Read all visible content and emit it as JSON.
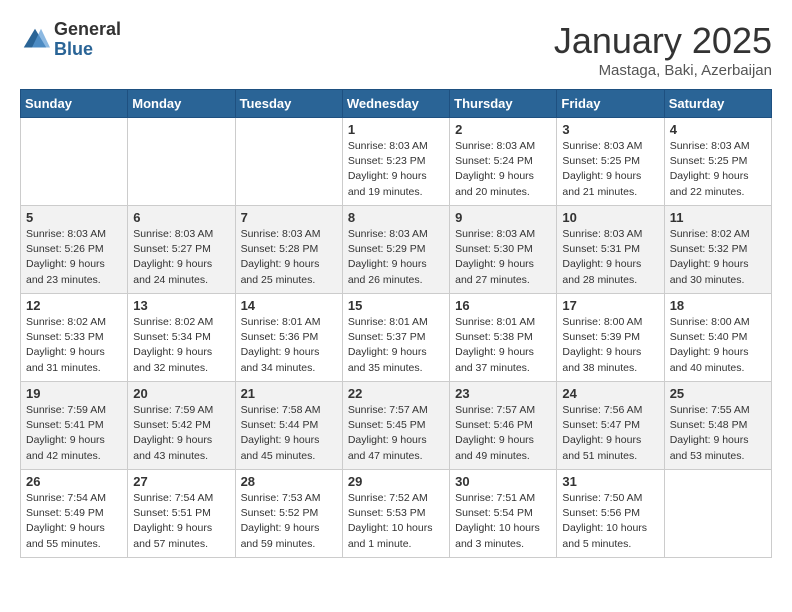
{
  "header": {
    "logo_general": "General",
    "logo_blue": "Blue",
    "month_title": "January 2025",
    "location": "Mastaga, Baki, Azerbaijan"
  },
  "days_of_week": [
    "Sunday",
    "Monday",
    "Tuesday",
    "Wednesday",
    "Thursday",
    "Friday",
    "Saturday"
  ],
  "weeks": [
    [
      {
        "day": "",
        "info": ""
      },
      {
        "day": "",
        "info": ""
      },
      {
        "day": "",
        "info": ""
      },
      {
        "day": "1",
        "info": "Sunrise: 8:03 AM\nSunset: 5:23 PM\nDaylight: 9 hours\nand 19 minutes."
      },
      {
        "day": "2",
        "info": "Sunrise: 8:03 AM\nSunset: 5:24 PM\nDaylight: 9 hours\nand 20 minutes."
      },
      {
        "day": "3",
        "info": "Sunrise: 8:03 AM\nSunset: 5:25 PM\nDaylight: 9 hours\nand 21 minutes."
      },
      {
        "day": "4",
        "info": "Sunrise: 8:03 AM\nSunset: 5:25 PM\nDaylight: 9 hours\nand 22 minutes."
      }
    ],
    [
      {
        "day": "5",
        "info": "Sunrise: 8:03 AM\nSunset: 5:26 PM\nDaylight: 9 hours\nand 23 minutes."
      },
      {
        "day": "6",
        "info": "Sunrise: 8:03 AM\nSunset: 5:27 PM\nDaylight: 9 hours\nand 24 minutes."
      },
      {
        "day": "7",
        "info": "Sunrise: 8:03 AM\nSunset: 5:28 PM\nDaylight: 9 hours\nand 25 minutes."
      },
      {
        "day": "8",
        "info": "Sunrise: 8:03 AM\nSunset: 5:29 PM\nDaylight: 9 hours\nand 26 minutes."
      },
      {
        "day": "9",
        "info": "Sunrise: 8:03 AM\nSunset: 5:30 PM\nDaylight: 9 hours\nand 27 minutes."
      },
      {
        "day": "10",
        "info": "Sunrise: 8:03 AM\nSunset: 5:31 PM\nDaylight: 9 hours\nand 28 minutes."
      },
      {
        "day": "11",
        "info": "Sunrise: 8:02 AM\nSunset: 5:32 PM\nDaylight: 9 hours\nand 30 minutes."
      }
    ],
    [
      {
        "day": "12",
        "info": "Sunrise: 8:02 AM\nSunset: 5:33 PM\nDaylight: 9 hours\nand 31 minutes."
      },
      {
        "day": "13",
        "info": "Sunrise: 8:02 AM\nSunset: 5:34 PM\nDaylight: 9 hours\nand 32 minutes."
      },
      {
        "day": "14",
        "info": "Sunrise: 8:01 AM\nSunset: 5:36 PM\nDaylight: 9 hours\nand 34 minutes."
      },
      {
        "day": "15",
        "info": "Sunrise: 8:01 AM\nSunset: 5:37 PM\nDaylight: 9 hours\nand 35 minutes."
      },
      {
        "day": "16",
        "info": "Sunrise: 8:01 AM\nSunset: 5:38 PM\nDaylight: 9 hours\nand 37 minutes."
      },
      {
        "day": "17",
        "info": "Sunrise: 8:00 AM\nSunset: 5:39 PM\nDaylight: 9 hours\nand 38 minutes."
      },
      {
        "day": "18",
        "info": "Sunrise: 8:00 AM\nSunset: 5:40 PM\nDaylight: 9 hours\nand 40 minutes."
      }
    ],
    [
      {
        "day": "19",
        "info": "Sunrise: 7:59 AM\nSunset: 5:41 PM\nDaylight: 9 hours\nand 42 minutes."
      },
      {
        "day": "20",
        "info": "Sunrise: 7:59 AM\nSunset: 5:42 PM\nDaylight: 9 hours\nand 43 minutes."
      },
      {
        "day": "21",
        "info": "Sunrise: 7:58 AM\nSunset: 5:44 PM\nDaylight: 9 hours\nand 45 minutes."
      },
      {
        "day": "22",
        "info": "Sunrise: 7:57 AM\nSunset: 5:45 PM\nDaylight: 9 hours\nand 47 minutes."
      },
      {
        "day": "23",
        "info": "Sunrise: 7:57 AM\nSunset: 5:46 PM\nDaylight: 9 hours\nand 49 minutes."
      },
      {
        "day": "24",
        "info": "Sunrise: 7:56 AM\nSunset: 5:47 PM\nDaylight: 9 hours\nand 51 minutes."
      },
      {
        "day": "25",
        "info": "Sunrise: 7:55 AM\nSunset: 5:48 PM\nDaylight: 9 hours\nand 53 minutes."
      }
    ],
    [
      {
        "day": "26",
        "info": "Sunrise: 7:54 AM\nSunset: 5:49 PM\nDaylight: 9 hours\nand 55 minutes."
      },
      {
        "day": "27",
        "info": "Sunrise: 7:54 AM\nSunset: 5:51 PM\nDaylight: 9 hours\nand 57 minutes."
      },
      {
        "day": "28",
        "info": "Sunrise: 7:53 AM\nSunset: 5:52 PM\nDaylight: 9 hours\nand 59 minutes."
      },
      {
        "day": "29",
        "info": "Sunrise: 7:52 AM\nSunset: 5:53 PM\nDaylight: 10 hours\nand 1 minute."
      },
      {
        "day": "30",
        "info": "Sunrise: 7:51 AM\nSunset: 5:54 PM\nDaylight: 10 hours\nand 3 minutes."
      },
      {
        "day": "31",
        "info": "Sunrise: 7:50 AM\nSunset: 5:56 PM\nDaylight: 10 hours\nand 5 minutes."
      },
      {
        "day": "",
        "info": ""
      }
    ]
  ]
}
